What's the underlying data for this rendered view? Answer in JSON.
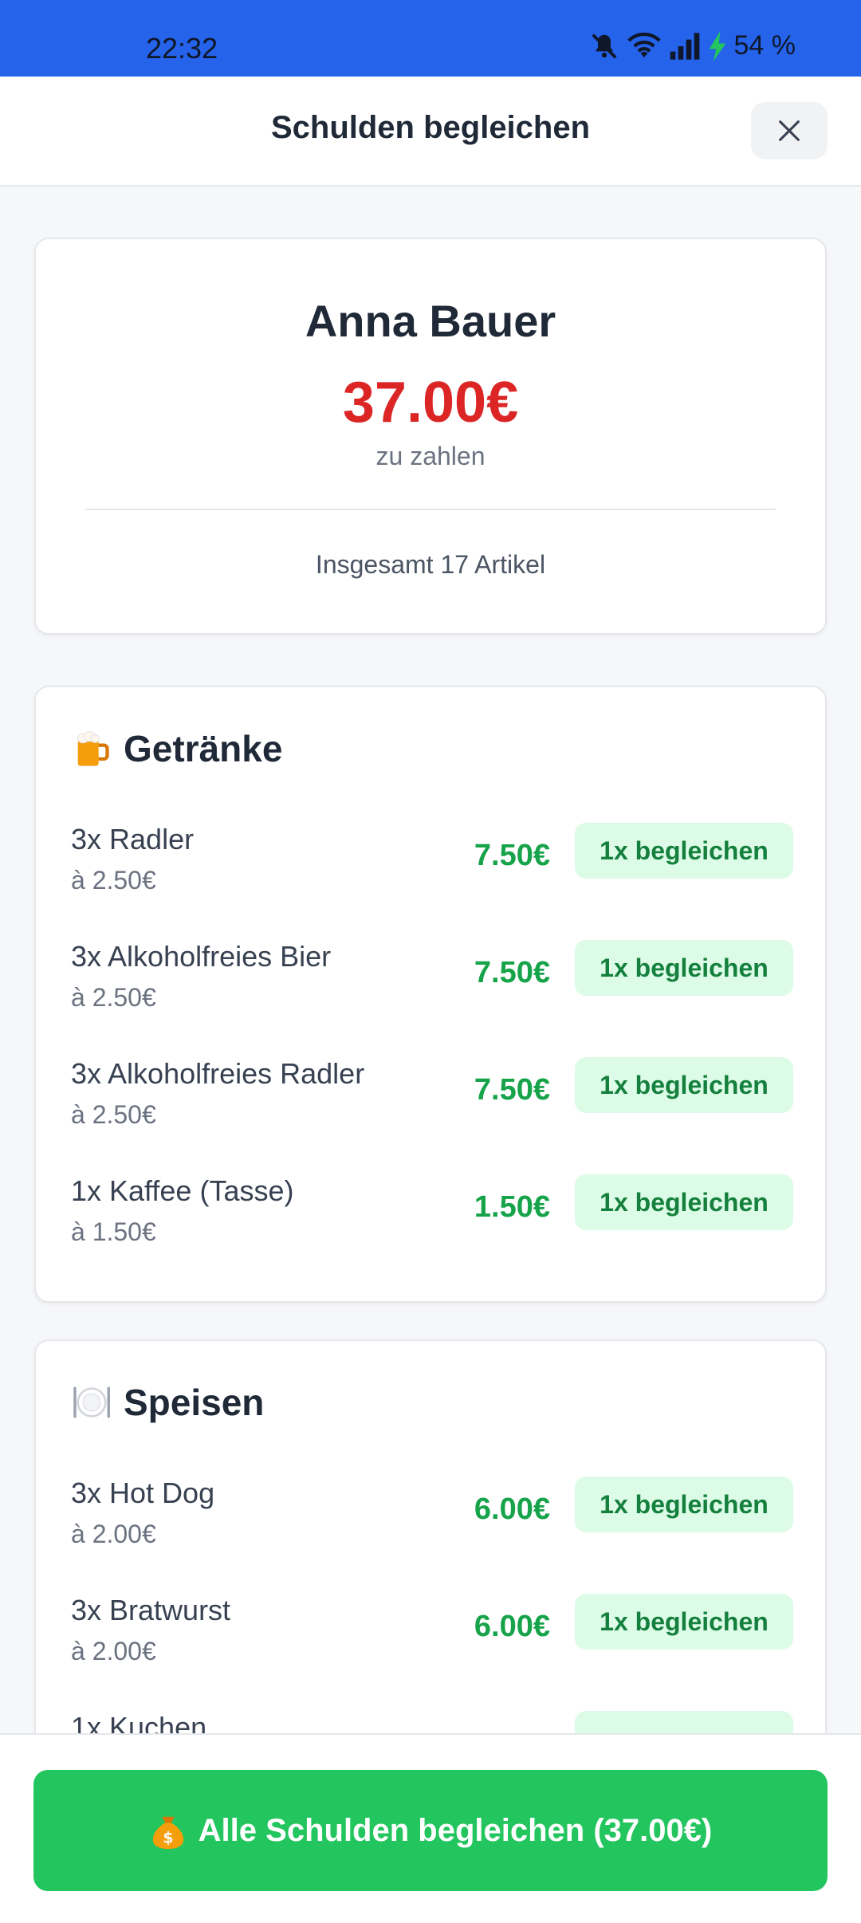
{
  "status": {
    "time": "22:32",
    "battery": "54 %"
  },
  "header": {
    "title": "Schulden begleichen"
  },
  "summary": {
    "name": "Anna Bauer",
    "amount": "37.00€",
    "amount_label": "zu zahlen",
    "total_items": "Insgesamt 17 Artikel"
  },
  "sections": [
    {
      "title": "Getränke",
      "icon": "beer-mug-icon",
      "items": [
        {
          "name": "3x Radler",
          "unit": "à 2.50€",
          "total": "7.50€",
          "action": "1x begleichen"
        },
        {
          "name": "3x Alkoholfreies Bier",
          "unit": "à 2.50€",
          "total": "7.50€",
          "action": "1x begleichen"
        },
        {
          "name": "3x Alkoholfreies Radler",
          "unit": "à 2.50€",
          "total": "7.50€",
          "action": "1x begleichen"
        },
        {
          "name": "1x Kaffee (Tasse)",
          "unit": "à 1.50€",
          "total": "1.50€",
          "action": "1x begleichen"
        }
      ]
    },
    {
      "title": "Speisen",
      "icon": "plate-cutlery-icon",
      "items": [
        {
          "name": "3x Hot Dog",
          "unit": "à 2.00€",
          "total": "6.00€",
          "action": "1x begleichen"
        },
        {
          "name": "3x Bratwurst",
          "unit": "à 2.00€",
          "total": "6.00€",
          "action": "1x begleichen"
        },
        {
          "name": "1x Kuchen",
          "unit": "",
          "total": "",
          "action": ""
        }
      ]
    }
  ],
  "footer": {
    "settle_all_label": "Alle Schulden begleichen (37.00€)",
    "icon": "money-bag-icon"
  },
  "colors": {
    "status_bar": "#2563eb",
    "debt": "#dc2626",
    "paid_green": "#16a34a",
    "button_green": "#22c55e",
    "badge_bg": "#dcfce7"
  }
}
